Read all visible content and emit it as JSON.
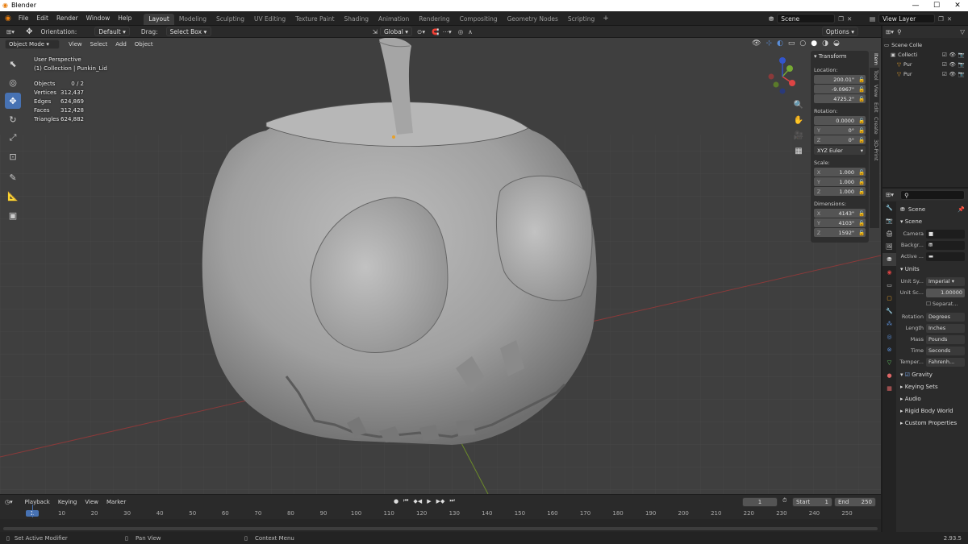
{
  "app": {
    "title": "Blender",
    "version": "2.93.5"
  },
  "menu": [
    "File",
    "Edit",
    "Render",
    "Window",
    "Help"
  ],
  "workspaces": [
    {
      "label": "Layout",
      "active": true
    },
    {
      "label": "Modeling"
    },
    {
      "label": "Sculpting"
    },
    {
      "label": "UV Editing"
    },
    {
      "label": "Texture Paint"
    },
    {
      "label": "Shading"
    },
    {
      "label": "Animation"
    },
    {
      "label": "Rendering"
    },
    {
      "label": "Compositing"
    },
    {
      "label": "Geometry Nodes"
    },
    {
      "label": "Scripting"
    }
  ],
  "scene_field": "Scene",
  "view_layer_field": "View Layer",
  "tool_header": {
    "orientation_label": "Orientation:",
    "orientation_value": "Default",
    "drag_label": "Drag:",
    "drag_value": "Select Box",
    "transform_orientation": "Global",
    "options": "Options"
  },
  "viewport_header": {
    "mode": "Object Mode",
    "menus": [
      "View",
      "Select",
      "Add",
      "Object"
    ]
  },
  "viewport_info": {
    "perspective": "User Perspective",
    "collection": "(1) Collection | Punkin_Lid",
    "stats": [
      {
        "key": "Objects",
        "value": "0 / 2"
      },
      {
        "key": "Vertices",
        "value": "312,437"
      },
      {
        "key": "Edges",
        "value": "624,869"
      },
      {
        "key": "Faces",
        "value": "312,428"
      },
      {
        "key": "Triangles",
        "value": "624,882"
      }
    ]
  },
  "npanel": {
    "title": "Transform",
    "location_label": "Location:",
    "location": [
      "200.01\"",
      "-9.0967\"",
      "4725.2\""
    ],
    "rotation_label": "Rotation:",
    "rotation": [
      {
        "axis": "",
        "value": "0.0000"
      },
      {
        "axis": "Y",
        "value": "0°"
      },
      {
        "axis": "Z",
        "value": "0°"
      }
    ],
    "rotation_mode": "XYZ Euler",
    "scale_label": "Scale:",
    "scale": [
      {
        "axis": "X",
        "value": "1.000"
      },
      {
        "axis": "Y",
        "value": "1.000"
      },
      {
        "axis": "Z",
        "value": "1.000"
      }
    ],
    "dimensions_label": "Dimensions:",
    "dimensions": [
      {
        "axis": "X",
        "value": "4143\""
      },
      {
        "axis": "Y",
        "value": "4103\""
      },
      {
        "axis": "Z",
        "value": "1592\""
      }
    ],
    "tabs": [
      "Item",
      "Tool",
      "View",
      "Edit",
      "Create",
      "3D-Print"
    ]
  },
  "outliner": {
    "items": [
      {
        "label": "Scene Colle"
      },
      {
        "label": "Collecti"
      },
      {
        "label": "Pur"
      },
      {
        "label": "Pur"
      }
    ]
  },
  "properties": {
    "header": "Scene",
    "scene_section": "Scene",
    "camera_label": "Camera",
    "background_label": "Backgr...",
    "active_label": "Active ...",
    "units_section": "Units",
    "unit_system_label": "Unit Sy...",
    "unit_system_value": "Imperial",
    "unit_scale_label": "Unit Sc...",
    "unit_scale_value": "1.00000",
    "separate_label": "Separat...",
    "rows": [
      {
        "label": "Rotation",
        "value": "Degrees"
      },
      {
        "label": "Length",
        "value": "Inches"
      },
      {
        "label": "Mass",
        "value": "Pounds"
      },
      {
        "label": "Time",
        "value": "Seconds"
      },
      {
        "label": "Temper...",
        "value": "Fahrenh..."
      }
    ],
    "gravity": "Gravity",
    "collapsed_sections": [
      "Keying Sets",
      "Audio",
      "Rigid Body World",
      "Custom Properties"
    ]
  },
  "timeline": {
    "menus": [
      "Playback",
      "Keying",
      "View",
      "Marker"
    ],
    "current_frame": "1",
    "start_label": "Start",
    "start": "1",
    "end_label": "End",
    "end": "250",
    "ruler": [
      "1",
      "10",
      "20",
      "30",
      "40",
      "50",
      "60",
      "70",
      "80",
      "90",
      "100",
      "110",
      "120",
      "130",
      "140",
      "150",
      "160",
      "170",
      "180",
      "190",
      "200",
      "210",
      "220",
      "230",
      "240",
      "250"
    ]
  },
  "statusbar": {
    "left": "Set Active Modifier",
    "middle": "Pan View",
    "right": "Context Menu"
  }
}
